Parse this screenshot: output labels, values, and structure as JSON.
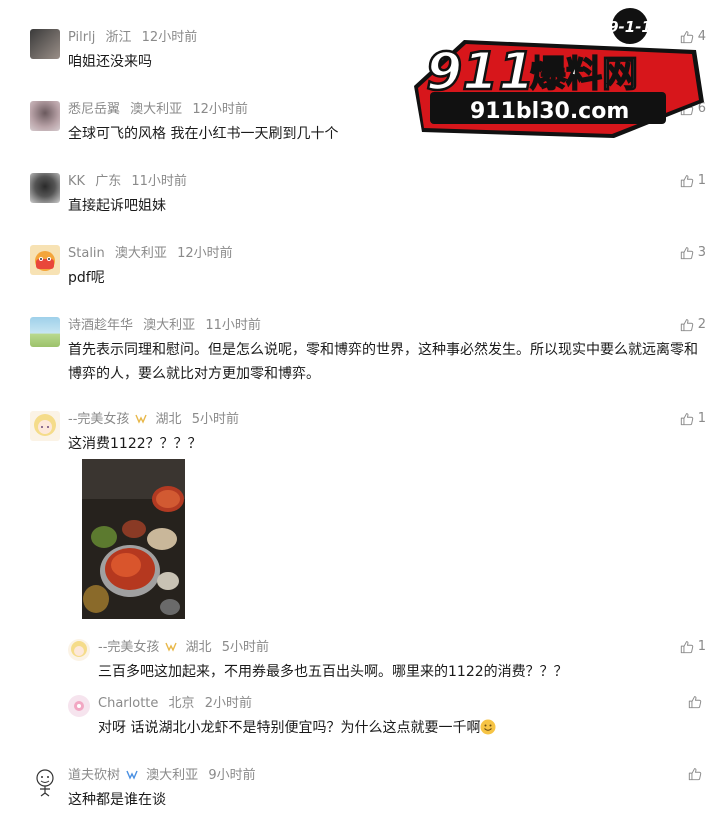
{
  "comments": [
    {
      "user": "Pilrlj",
      "region": "浙江",
      "time": "12小时前",
      "text": "咱姐还没来吗",
      "likes": "4"
    },
    {
      "user": "悉尼岳翼",
      "region": "澳大利亚",
      "time": "12小时前",
      "text": "全球可飞的风格 我在小红书一天刷到几十个",
      "likes": "6"
    },
    {
      "user": "KK",
      "region": "广东",
      "time": "11小时前",
      "text": "直接起诉吧姐妹",
      "likes": "1"
    },
    {
      "user": "Stalin",
      "region": "澳大利亚",
      "time": "12小时前",
      "text": "pdf呢",
      "likes": "3"
    },
    {
      "user": "诗酒趁年华",
      "region": "澳大利亚",
      "time": "11小时前",
      "text": "首先表示同理和慰问。但是怎么说呢，零和博弈的世界，这种事必然发生。所以现实中要么就远离零和博弈的人，要么就比对方更加零和博弈。",
      "likes": "2"
    },
    {
      "user": "--完美女孩",
      "region": "湖北",
      "time": "5小时前",
      "text": "这消费1122？？？？",
      "likes": "1"
    },
    {
      "user": "道夫砍树",
      "region": "澳大利亚",
      "time": "9小时前",
      "text": "这种都是谁在谈",
      "likes": ""
    }
  ],
  "replies": [
    {
      "user": "--完美女孩",
      "region": "湖北",
      "time": "5小时前",
      "text": "三百多吧这加起来，不用券最多也五百出头啊。哪里来的1122的消费？？？",
      "likes": "1"
    },
    {
      "user": "Charlotte",
      "region": "北京",
      "time": "2小时前",
      "text": "对呀 话说湖北小龙虾不是特别便宜吗？为什么这点就要一千啊",
      "likes": ""
    }
  ],
  "logo": {
    "main": "911",
    "cn": "爆料网",
    "url": "911bl30.com",
    "badge": "9-1-1"
  },
  "colors": {
    "meta": "#8a8a8a",
    "text": "#1a1a1a",
    "logo_red": "#d7161b"
  }
}
